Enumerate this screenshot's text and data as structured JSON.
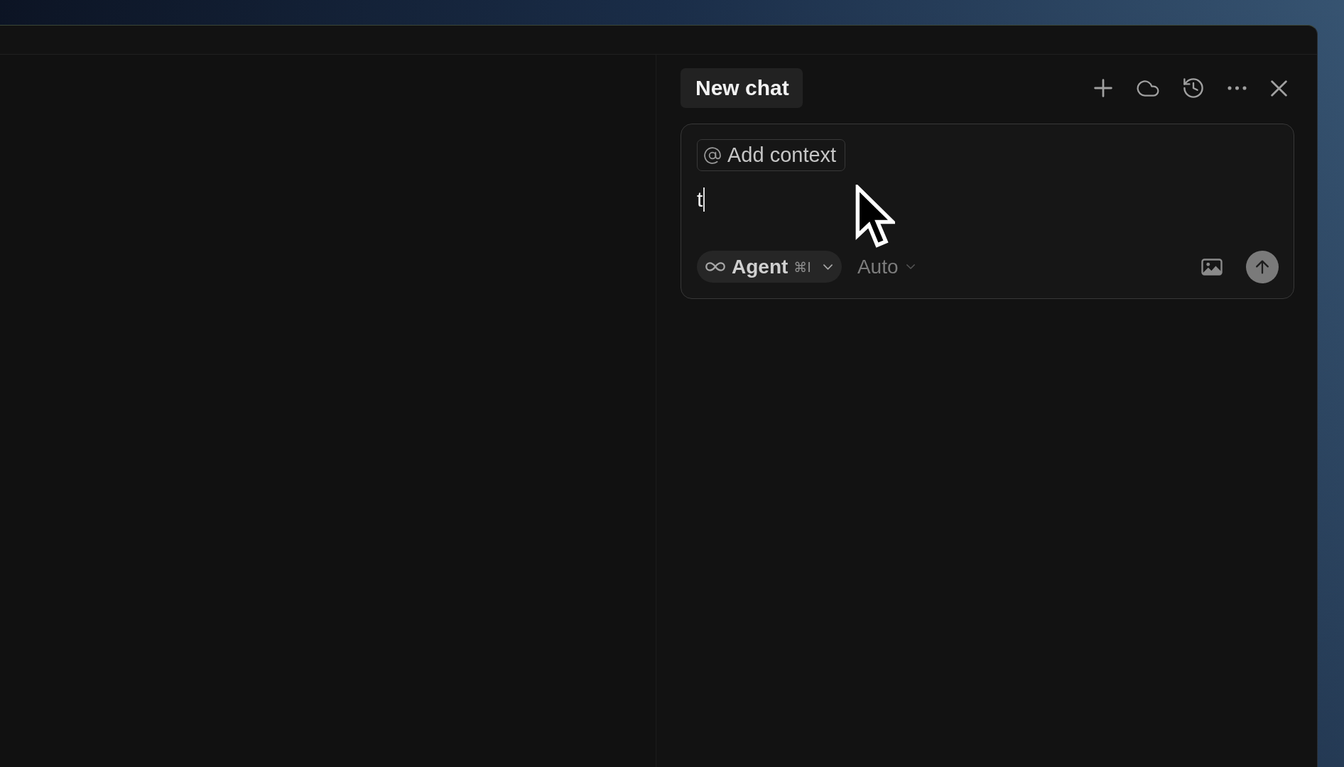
{
  "chat_panel": {
    "tab": {
      "label": "New chat",
      "selected": true
    },
    "composer": {
      "context_button": {
        "label": "Add context"
      },
      "message": {
        "value": "t"
      },
      "mode_selector": {
        "label": "Agent",
        "shortcut": "⌘I"
      },
      "model_selector": {
        "label": "Auto"
      }
    }
  }
}
